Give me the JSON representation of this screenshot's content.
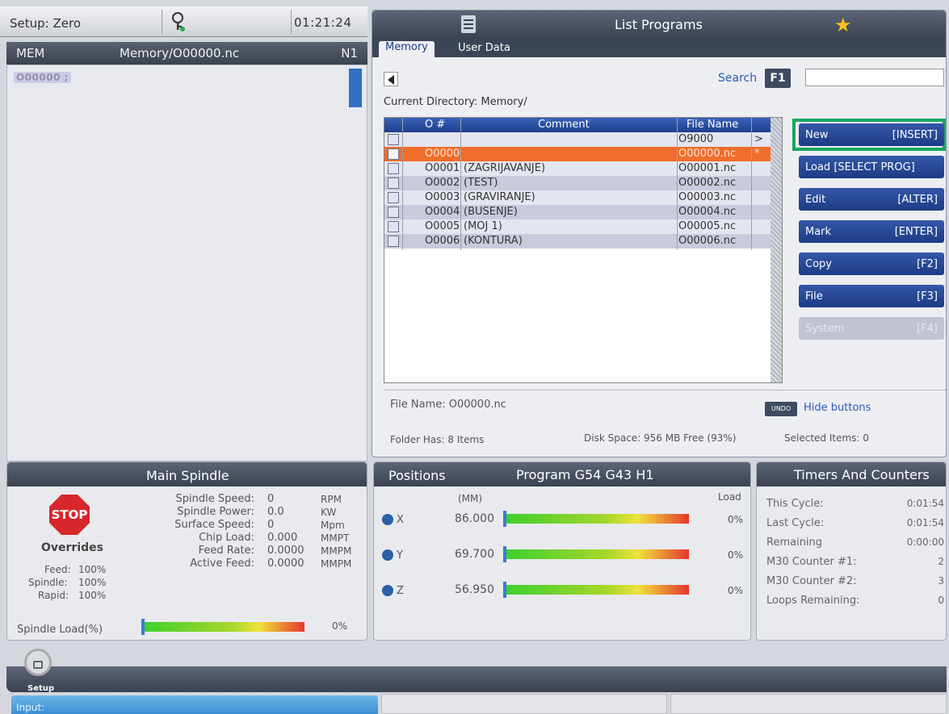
{
  "status_bar": {
    "setup": "Setup: Zero",
    "clock": "01:21:24"
  },
  "program_panel": {
    "mode": "MEM",
    "path": "Memory/O00000.nc",
    "line": "N1",
    "current_line": "O00000 ;"
  },
  "list_programs": {
    "title": "List Programs",
    "tabs": [
      "Memory",
      "User Data"
    ],
    "search_label": "Search",
    "search_key": "F1",
    "search_value": "",
    "current_directory": "Current Directory: Memory/",
    "columns": {
      "onum": "O #",
      "comment": "Comment",
      "file_name": "File Name"
    },
    "rows": [
      {
        "onum": "",
        "comment": "",
        "file_name": "O9000",
        "flag": ">"
      },
      {
        "onum": "O0000",
        "comment": "",
        "file_name": "O00000.nc",
        "flag": "*"
      },
      {
        "onum": "O0001",
        "comment": "(ZAGRIJAVANJE)",
        "file_name": "O00001.nc",
        "flag": ""
      },
      {
        "onum": "O0002",
        "comment": "(TEST)",
        "file_name": "O00002.nc",
        "flag": ""
      },
      {
        "onum": "O0003",
        "comment": "(GRAVIRANJE)",
        "file_name": "O00003.nc",
        "flag": ""
      },
      {
        "onum": "O0004",
        "comment": "(BUSENJE)",
        "file_name": "O00004.nc",
        "flag": ""
      },
      {
        "onum": "O0005",
        "comment": "(MOJ 1)",
        "file_name": "O00005.nc",
        "flag": ""
      },
      {
        "onum": "O0006",
        "comment": "(KONTURA)",
        "file_name": "O00006.nc",
        "flag": ""
      }
    ],
    "buttons": [
      {
        "label": "New",
        "key": "[INSERT]"
      },
      {
        "label": "Load [SELECT PROG]",
        "key": ""
      },
      {
        "label": "Edit",
        "key": "[ALTER]"
      },
      {
        "label": "Mark",
        "key": "[ENTER]"
      },
      {
        "label": "Copy",
        "key": "[F2]"
      },
      {
        "label": "File",
        "key": "[F3]"
      },
      {
        "label": "System",
        "key": "[F4]"
      }
    ],
    "file_name_info": "File Name: O00000.nc",
    "undo_label": "UNDO",
    "hide_buttons": "Hide buttons",
    "folder_has": "Folder Has: 8 Items",
    "disk_space": "Disk Space: 956 MB Free (93%)",
    "selected_items": "Selected Items: 0"
  },
  "main_spindle": {
    "title": "Main Spindle",
    "stop": "STOP",
    "overrides_label": "Overrides",
    "overrides": [
      {
        "label": "Feed:",
        "value": "100%"
      },
      {
        "label": "Spindle:",
        "value": "100%"
      },
      {
        "label": "Rapid:",
        "value": "100%"
      }
    ],
    "params": [
      {
        "label": "Spindle Speed:",
        "value": "0",
        "unit": "RPM"
      },
      {
        "label": "Spindle Power:",
        "value": "0.0",
        "unit": "KW"
      },
      {
        "label": "Surface Speed:",
        "value": "0",
        "unit": "Mpm"
      },
      {
        "label": "Chip Load:",
        "value": "0.000",
        "unit": "MMPT"
      },
      {
        "label": "Feed Rate:",
        "value": "0.0000",
        "unit": "MMPM"
      },
      {
        "label": "Active Feed:",
        "value": "0.0000",
        "unit": "MMPM"
      }
    ],
    "spindle_load_label": "Spindle Load(%)",
    "spindle_load_value": "0%",
    "spindle_load_fraction": 0.0
  },
  "positions": {
    "title": "Positions",
    "program": "Program G54 G43 H1",
    "units": "(MM)",
    "load_header": "Load",
    "axes": [
      {
        "axis": "X",
        "value": "86.000",
        "load": "0%"
      },
      {
        "axis": "Y",
        "value": "69.700",
        "load": "0%"
      },
      {
        "axis": "Z",
        "value": "56.950",
        "load": "0%"
      }
    ]
  },
  "timers": {
    "title": "Timers And Counters",
    "items": [
      {
        "label": "This Cycle:",
        "value": "0:01:54"
      },
      {
        "label": "Last Cycle:",
        "value": "0:01:54"
      },
      {
        "label": "Remaining",
        "value": "0:00:00"
      },
      {
        "label": "M30 Counter #1:",
        "value": "2"
      },
      {
        "label": "M30 Counter #2:",
        "value": "3"
      },
      {
        "label": "Loops Remaining:",
        "value": "0"
      }
    ]
  },
  "footer": {
    "setup_tab": "Setup",
    "input_label": "Input:"
  }
}
